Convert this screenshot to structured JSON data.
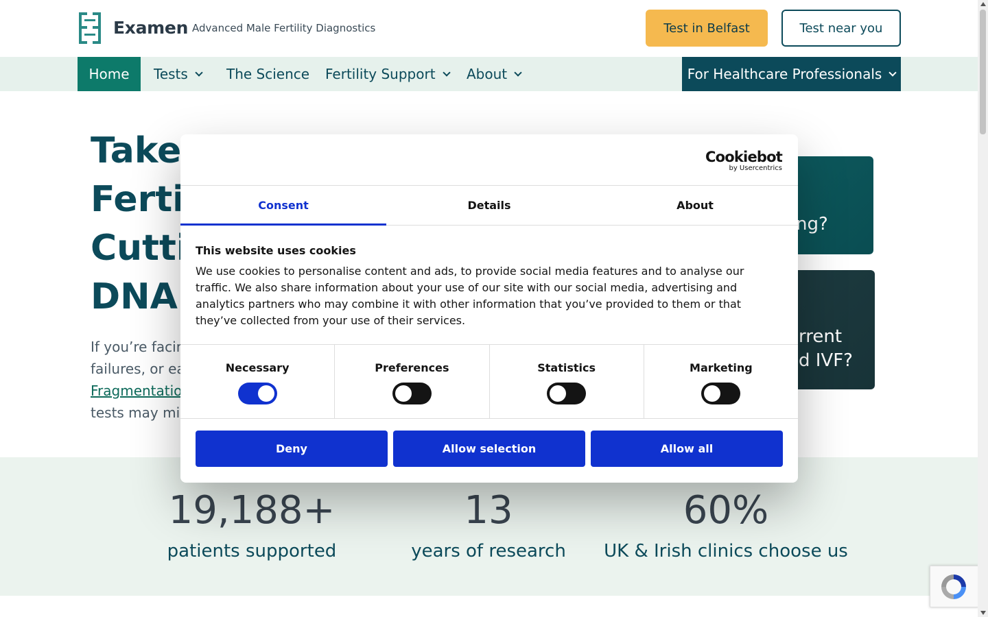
{
  "header": {
    "brand": "Examen",
    "tagline": "Advanced Male Fertility Diagnostics",
    "btn_belfast": "Test in Belfast",
    "btn_near": "Test near you"
  },
  "nav": {
    "home": "Home",
    "tests": "Tests",
    "science": "The Science",
    "support": "Fertility Support",
    "about": "About",
    "hcp": "For Healthcare Professionals"
  },
  "hero": {
    "line1": "Take C",
    "line2": "Fertili",
    "line3": "Cuttin",
    "line4": "DNA T",
    "text1": "If you’re facin",
    "text2": "failures, or ea",
    "text3_link": "Fragmentatio",
    "text4": "tests may mis",
    "card1_text": "ng?",
    "card2_text_1": "rrent",
    "card2_text_2": "d IVF?"
  },
  "stats": [
    {
      "value": "19,188+",
      "label": "patients supported"
    },
    {
      "value": "13",
      "label": "years of research"
    },
    {
      "value": "60%",
      "label": "UK & Irish clinics choose us"
    }
  ],
  "cookie": {
    "brand": "Cookiebot",
    "by": "by Usercentrics",
    "tabs": [
      "Consent",
      "Details",
      "About"
    ],
    "title": "This website uses cookies",
    "body": "We use cookies to personalise content and ads, to provide social media features and to analyse our traffic. We also share information about your use of our site with our social media, advertising and analytics partners who may combine it with other information that you’ve provided to them or that they’ve collected from your use of their services.",
    "toggles": [
      {
        "label": "Necessary",
        "on": true
      },
      {
        "label": "Preferences",
        "on": false
      },
      {
        "label": "Statistics",
        "on": false
      },
      {
        "label": "Marketing",
        "on": false
      }
    ],
    "buttons": [
      "Deny",
      "Allow selection",
      "Allow all"
    ],
    "accent": "#1032cf"
  },
  "colors": {
    "primary": "#0c4a5a",
    "nav_active": "#0d7a6a",
    "cta_yellow": "#f5b94f",
    "nav_bg": "#e6f1ec"
  }
}
